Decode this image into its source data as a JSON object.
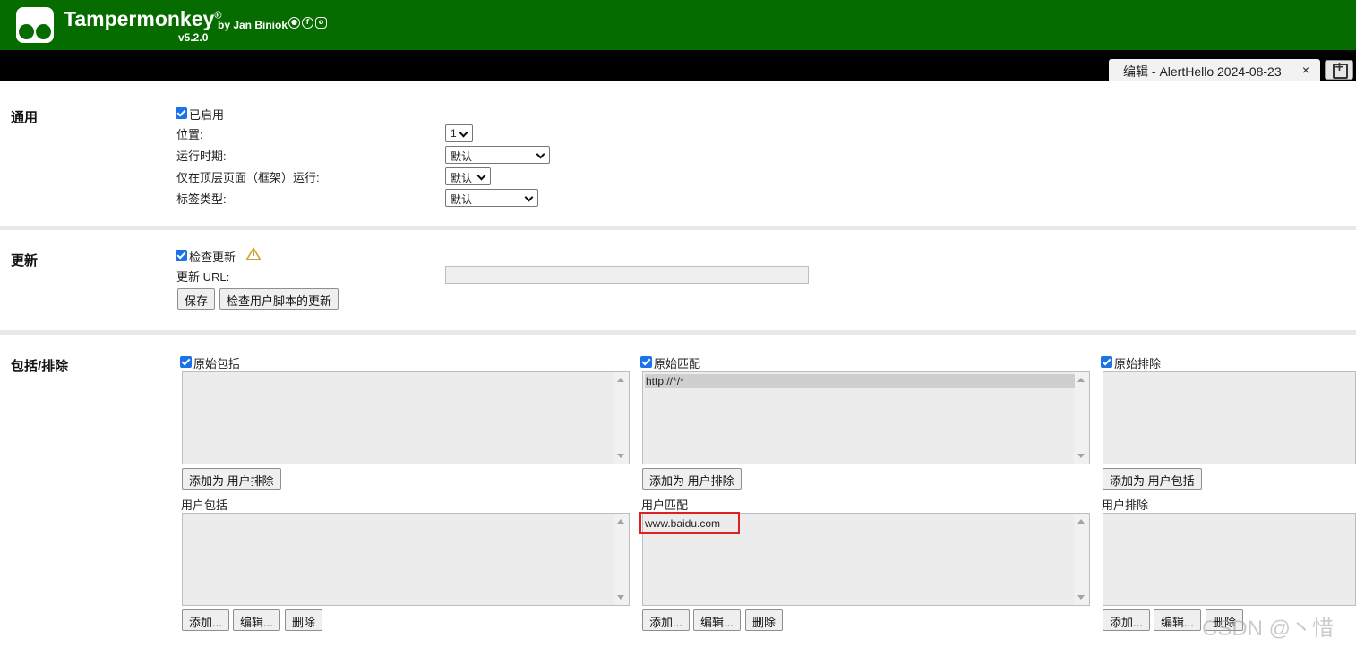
{
  "header": {
    "app_name": "Tampermonkey",
    "registered": "®",
    "byline": "by Jan Biniok",
    "version": "v5.2.0",
    "social_icons": [
      "github-icon",
      "facebook-icon",
      "instagram-icon"
    ],
    "brand_color": "#066c00"
  },
  "tabs": {
    "active_label": "编辑 - AlertHello 2024-08-23",
    "close_glyph": "×"
  },
  "general": {
    "title": "通用",
    "enabled_label": "已启用",
    "enabled_checked": true,
    "position_label": "位置:",
    "position_value": "1",
    "run_at_label": "运行时期:",
    "run_at_value": "默认",
    "top_frame_label": "仅在顶层页面（框架）运行:",
    "top_frame_value": "默认",
    "tag_type_label": "标签类型:",
    "tag_type_value": "默认"
  },
  "update": {
    "title": "更新",
    "check_label": "检查更新",
    "check_checked": true,
    "url_label": "更新 URL:",
    "url_value": "",
    "save_button": "保存",
    "check_updates_button": "检查用户脚本的更新"
  },
  "include_exclude": {
    "title": "包括/排除",
    "original_include": {
      "label": "原始包括",
      "checked": true,
      "items": [],
      "add_button": "添加为 用户排除"
    },
    "original_match": {
      "label": "原始匹配",
      "checked": true,
      "items": [
        "http://*/*"
      ],
      "add_button": "添加为 用户排除"
    },
    "original_exclude": {
      "label": "原始排除",
      "checked": true,
      "items": [],
      "add_button": "添加为 用户包括"
    },
    "user_include": {
      "label": "用户包括",
      "items": [],
      "add_button": "添加...",
      "edit_button": "编辑...",
      "delete_button": "删除"
    },
    "user_match": {
      "label": "用户匹配",
      "items": [
        "www.baidu.com"
      ],
      "add_button": "添加...",
      "edit_button": "编辑...",
      "delete_button": "删除"
    },
    "user_exclude": {
      "label": "用户排除",
      "items": [],
      "add_button": "添加...",
      "edit_button": "编辑...",
      "delete_button": "删除"
    }
  },
  "watermark": "CSDN @丶惜"
}
